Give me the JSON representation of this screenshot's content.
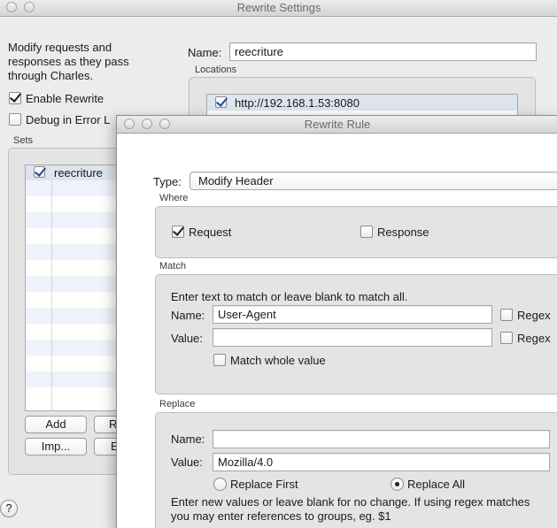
{
  "settings_window": {
    "title": "Rewrite Settings",
    "description": "Modify requests and responses as they pass through Charles.",
    "enable_rewrite_label": "Enable Rewrite",
    "enable_rewrite_checked": true,
    "debug_label": "Debug in Error L",
    "debug_checked": false,
    "sets_label": "Sets",
    "sets": [
      {
        "name": "reecriture",
        "checked": true
      }
    ],
    "add_label": "Add",
    "remove_label_partial": "R",
    "import_label": "Imp...",
    "export_label_partial": "E",
    "name_label": "Name:",
    "name_value": "reecriture",
    "locations_label": "Locations",
    "locations": [
      {
        "url": "http://192.168.1.53:8080",
        "checked": true
      }
    ],
    "help_label": "?"
  },
  "rule_window": {
    "title": "Rewrite Rule",
    "type_label": "Type:",
    "type_value": "Modify Header",
    "where": {
      "label": "Where",
      "request_label": "Request",
      "request_checked": true,
      "response_label": "Response",
      "response_checked": false
    },
    "match": {
      "label": "Match",
      "hint": "Enter text to match or leave blank to match all.",
      "name_label": "Name:",
      "name_value": "User-Agent",
      "name_regex_label": "Regex",
      "name_regex_checked": false,
      "value_label": "Value:",
      "value_value": "",
      "value_regex_label": "Regex",
      "value_regex_checked": false,
      "whole_value_label": "Match whole value",
      "whole_value_checked": false
    },
    "replace": {
      "label": "Replace",
      "name_label": "Name:",
      "name_value": "",
      "value_label": "Value:",
      "value_value": "Mozilla/4.0",
      "replace_first_label": "Replace First",
      "replace_all_label": "Replace All",
      "selected_mode": "Replace All",
      "hint": "Enter new values or leave blank for no change. If using regex matches you may enter references to groups, eg. $1"
    }
  }
}
